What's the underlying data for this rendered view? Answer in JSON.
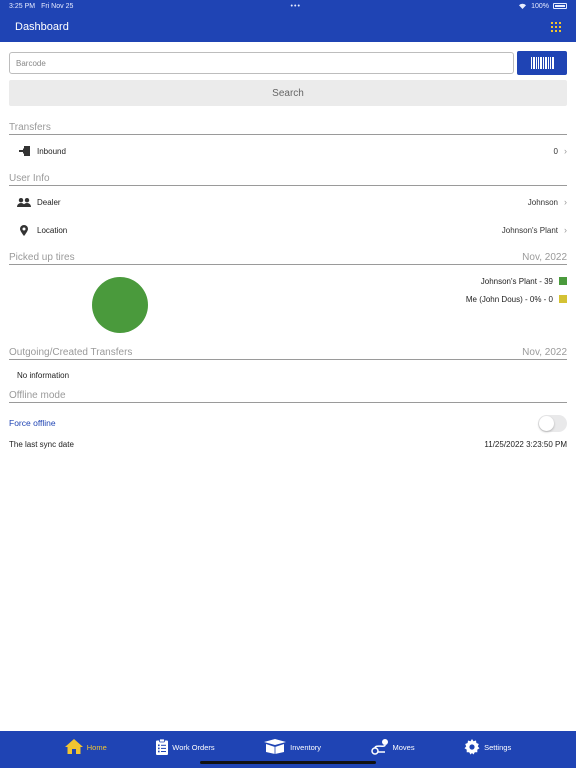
{
  "status_bar": {
    "time": "3:25 PM",
    "date": "Fri Nov 25",
    "dots": "•••",
    "battery": "100%"
  },
  "header": {
    "title": "Dashboard"
  },
  "barcode": {
    "placeholder": "Barcode"
  },
  "search_button": "Search",
  "transfers": {
    "title": "Transfers",
    "inbound": {
      "label": "Inbound",
      "value": "0"
    }
  },
  "user_info": {
    "title": "User Info",
    "dealer": {
      "label": "Dealer",
      "value": "Johnson"
    },
    "location": {
      "label": "Location",
      "value": "Johnson's Plant"
    }
  },
  "picked_up_tires": {
    "title": "Picked up tires",
    "period": "Nov, 2022"
  },
  "chart_data": {
    "type": "pie",
    "title": "",
    "series": [
      {
        "label": "Johnson's Plant - 39",
        "value": 39,
        "color": "#4a9a3c"
      },
      {
        "label": "Me (John Dous) - 0% - 0",
        "value": 0,
        "color": "#d4c234"
      }
    ]
  },
  "outgoing": {
    "title": "Outgoing/Created Transfers",
    "period": "Nov, 2022",
    "empty_text": "No information"
  },
  "offline": {
    "title": "Offline mode",
    "force_label": "Force offline",
    "force_enabled": false,
    "sync_label": "The last sync date",
    "sync_value": "11/25/2022 3:23:50 PM"
  },
  "tabs": [
    {
      "label": "Home",
      "icon": "home-icon",
      "active": true
    },
    {
      "label": "Work Orders",
      "icon": "clipboard-icon",
      "active": false
    },
    {
      "label": "Inventory",
      "icon": "box-icon",
      "active": false
    },
    {
      "label": "Moves",
      "icon": "route-icon",
      "active": false
    },
    {
      "label": "Settings",
      "icon": "gear-icon",
      "active": false
    }
  ],
  "colors": {
    "brand": "#1f44b4",
    "accent": "#f2c531"
  }
}
